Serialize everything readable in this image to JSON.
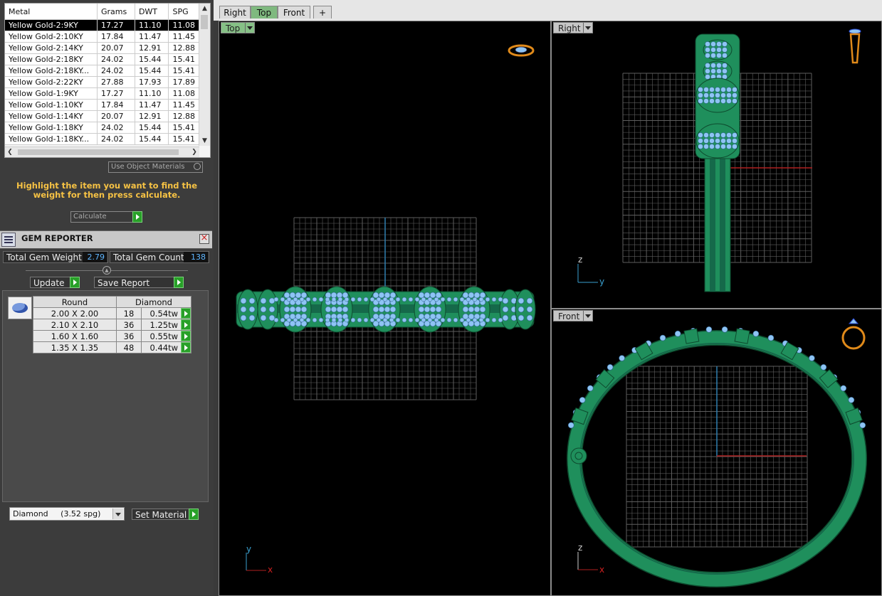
{
  "metal_table": {
    "columns": [
      "Metal",
      "Grams",
      "DWT",
      "SPG"
    ],
    "rows": [
      [
        "Yellow Gold-2:9KY",
        "17.27",
        "11.10",
        "11.08"
      ],
      [
        "Yellow Gold-2:10KY",
        "17.84",
        "11.47",
        "11.45"
      ],
      [
        "Yellow Gold-2:14KY",
        "20.07",
        "12.91",
        "12.88"
      ],
      [
        "Yellow Gold-2:18KY",
        "24.02",
        "15.44",
        "15.41"
      ],
      [
        "Yellow Gold-2:18KY...",
        "24.02",
        "15.44",
        "15.41"
      ],
      [
        "Yellow Gold-2:22KY",
        "27.88",
        "17.93",
        "17.89"
      ],
      [
        "Yellow Gold-1:9KY",
        "17.27",
        "11.10",
        "11.08"
      ],
      [
        "Yellow Gold-1:10KY",
        "17.84",
        "11.47",
        "11.45"
      ],
      [
        "Yellow Gold-1:14KY",
        "20.07",
        "12.91",
        "12.88"
      ],
      [
        "Yellow Gold-1:18KY",
        "24.02",
        "15.44",
        "15.41"
      ],
      [
        "Yellow Gold-1:18KY...",
        "24.02",
        "15.44",
        "15.41"
      ]
    ]
  },
  "use_object_materials": "Use Object Materials",
  "instructions": "Highlight the item you want to find the weight for then press calculate.",
  "calculate_label": "Calculate",
  "gem_reporter": {
    "title": "GEM REPORTER",
    "total_weight_label": "Total Gem Weight",
    "total_weight": "2.79",
    "total_count_label": "Total Gem Count",
    "total_count": "138",
    "update_label": "Update",
    "save_report_label": "Save Report",
    "shape_header": "Round",
    "stone_header": "Diamond",
    "rows": [
      {
        "size": "2.00 X 2.00",
        "count": "18",
        "weight": "0.54tw"
      },
      {
        "size": "2.10 X 2.10",
        "count": "36",
        "weight": "1.25tw"
      },
      {
        "size": "1.60 X 1.60",
        "count": "36",
        "weight": "0.55tw"
      },
      {
        "size": "1.35 X 1.35",
        "count": "48",
        "weight": "0.44tw"
      }
    ]
  },
  "material_select": "Diamond     (3.52 spg)",
  "set_material_label": "Set Material",
  "tabs": [
    "Right",
    "Top",
    "Front",
    "+"
  ],
  "active_tab": "Top",
  "viewports": {
    "top": {
      "label": "Top",
      "axes": [
        "x",
        "y"
      ]
    },
    "right": {
      "label": "Right",
      "axes": [
        "y",
        "z"
      ]
    },
    "front": {
      "label": "Front",
      "axes": [
        "x",
        "z"
      ]
    }
  },
  "colors": {
    "ring_green": "#1f8f5c",
    "gem_blue": "#8ec4f4",
    "grid": "#5e5e5e",
    "accent_yellow": "#f6c244",
    "value_blue": "#5fb6ff"
  }
}
